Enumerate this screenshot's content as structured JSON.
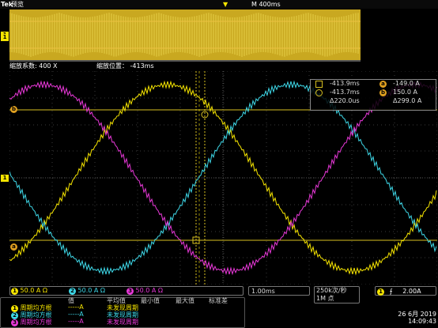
{
  "header": {
    "brand": "Tek",
    "mode": "预览",
    "timebase": "M 400ms"
  },
  "zoom": {
    "factor": "缩放系数: 400 X",
    "position": "缩放位置：  -413ms"
  },
  "overview": {
    "channel": "1"
  },
  "plot_markers": {
    "ch1_left": "1",
    "b_marker": "b",
    "a_marker": "a"
  },
  "readout": {
    "t1": "-413.9ms",
    "t2": "-413.7ms",
    "dt": "Δ220.0us",
    "a_val": "-149.0 A",
    "b_val": "150.0 A",
    "dv": "Δ299.0 A",
    "a_label": "a",
    "b_label": "b"
  },
  "channels": [
    {
      "num": "1",
      "scale": "50.0 A",
      "unit": "Ω",
      "color": "#f5e400"
    },
    {
      "num": "2",
      "scale": "50.0 A",
      "unit": "Ω",
      "color": "#3ed8e8"
    },
    {
      "num": "3",
      "scale": "50.0 A",
      "unit": "Ω",
      "color": "#e838d8"
    }
  ],
  "horiz": {
    "scale": "1.00ms",
    "rate": "250k次/秒",
    "points": "1M 点"
  },
  "trigger": {
    "channel": "1",
    "slope": "⨍",
    "level": "2.00A"
  },
  "meas_headers": [
    "值",
    "平均值",
    "最小值",
    "最大值",
    "标准差"
  ],
  "measurements": [
    {
      "num": "1",
      "name": "周期均方根",
      "value": "-----A",
      "mean": "未发现周期"
    },
    {
      "num": "2",
      "name": "周期均方根",
      "value": "-----A",
      "mean": "未发现周期"
    },
    {
      "num": "3",
      "name": "周期均方根",
      "value": "-----A",
      "mean": "未发现周期"
    }
  ],
  "datetime": {
    "date": "26 6月  2019",
    "time": "14:09:43"
  },
  "colors": {
    "ch1": "#f5e400",
    "ch2": "#3ed8e8",
    "ch3": "#e838d8",
    "cursor": "#d8c020",
    "grid": "#3a3a3a"
  }
}
